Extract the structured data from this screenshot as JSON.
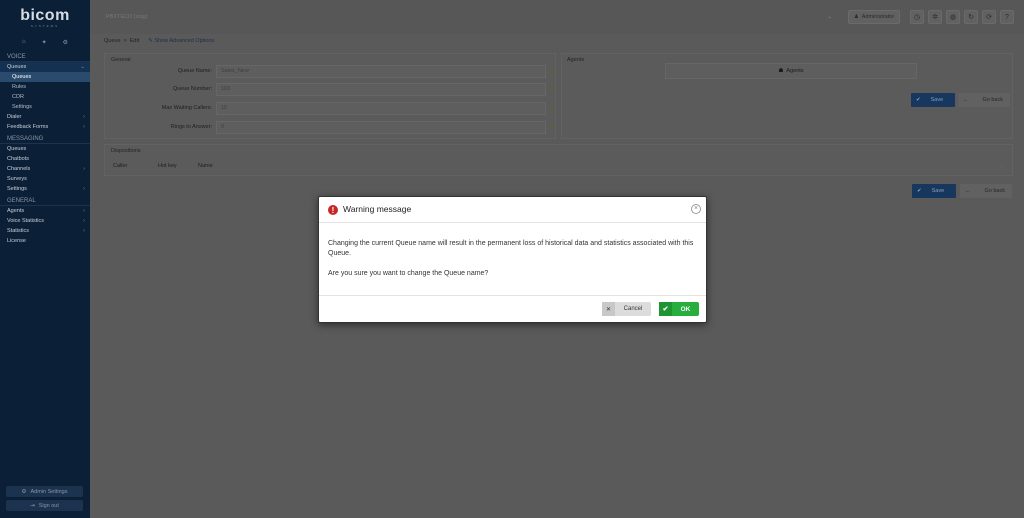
{
  "brand": {
    "logo": "bicom",
    "logo_sub": "SYSTEMS"
  },
  "sidebar": {
    "top_icons": [
      "home-icon",
      "pin-icon",
      "sitemap-icon"
    ],
    "sections": [
      {
        "title": "VOICE",
        "items": [
          {
            "label": "Queues",
            "chevron": true,
            "active": true
          },
          {
            "label": "Queues",
            "sub": true,
            "selected": true
          },
          {
            "label": "Rules",
            "sub": true
          },
          {
            "label": "CDR",
            "sub": true
          },
          {
            "label": "Settings",
            "sub": true
          },
          {
            "label": "Dialer",
            "chevron": true
          },
          {
            "label": "Feedback Forms",
            "chevron": true
          }
        ]
      },
      {
        "title": "MESSAGING",
        "items": [
          {
            "label": "Queues"
          },
          {
            "label": "Chatbots"
          },
          {
            "label": "Channels",
            "chevron": true
          },
          {
            "label": "Surveys"
          },
          {
            "label": "Settings",
            "chevron": true
          }
        ]
      },
      {
        "title": "GENERAL",
        "items": [
          {
            "label": "Agents",
            "chevron": true
          },
          {
            "label": "Voice Statistics",
            "chevron": true
          },
          {
            "label": "Statistics",
            "chevron": true
          },
          {
            "label": "License"
          }
        ]
      }
    ],
    "admin_settings": "Admin Settings",
    "sign_out": "Sign out"
  },
  "topbar": {
    "tenant": "PBXTECO (slug)",
    "user": "Administrator",
    "icons": [
      "clock-icon",
      "bug-icon",
      "globe-icon",
      "refresh-icon",
      "sync-icon",
      "help-icon"
    ]
  },
  "breadcrumb": {
    "root": "Queue",
    "sep": ">",
    "current": "Edit",
    "advanced": "Show Advanced Options"
  },
  "general": {
    "title": "General",
    "fields": [
      {
        "label": "Queue Name:",
        "value": "Sales_New"
      },
      {
        "label": "Queue Number:",
        "value": "103"
      },
      {
        "label": "Max Waiting Callers:",
        "value": "10"
      },
      {
        "label": "Rings to Answer:",
        "value": "0"
      }
    ]
  },
  "agents": {
    "title": "Agents",
    "header": "Agents"
  },
  "actions": {
    "save": "Save",
    "back": "Go back"
  },
  "dispositions": {
    "title": "Dispositions",
    "columns": [
      "Caller",
      "Hot key",
      "Name"
    ]
  },
  "modal": {
    "title": "Warning message",
    "message": "Changing the current Queue name will result in the permanent loss of historical data and statistics associated with this Queue.",
    "question": "Are you sure you want to change the Queue name?",
    "cancel": "Cancel",
    "ok": "OK",
    "colors": {
      "warning": "#c62828",
      "ok": "#27ae3d",
      "cancel": "#dcdcdc"
    }
  }
}
